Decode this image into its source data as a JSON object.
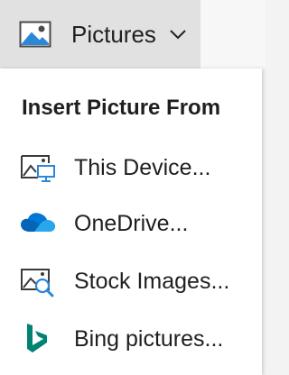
{
  "ribbon": {
    "pictures_button": {
      "label": "Pictures",
      "icon": "picture-icon",
      "dropdown_icon": "chevron-down-icon"
    }
  },
  "menu": {
    "heading": "Insert Picture From",
    "items": [
      {
        "label": "This Device...",
        "icon": "this-device-icon"
      },
      {
        "label": "OneDrive...",
        "icon": "onedrive-cloud-icon"
      },
      {
        "label": "Stock Images...",
        "icon": "stock-images-icon"
      },
      {
        "label": "Bing pictures...",
        "icon": "bing-logo-icon"
      }
    ]
  },
  "colors": {
    "accent_blue": "#2b88d8",
    "onedrive_blue": "#0364b8",
    "bing_teal": "#008373",
    "hover_gray": "#e1e1e1"
  }
}
